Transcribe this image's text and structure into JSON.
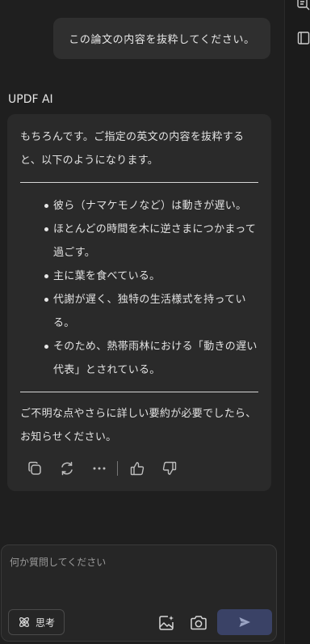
{
  "user_message": "この論文の内容を抜粋してください。",
  "assistant": {
    "name": "UPDF AI",
    "intro": "もちろんです。ご指定の英文の内容を抜粋すると、以下のようになります。",
    "bullets": [
      "彼ら（ナマケモノなど）は動きが遅い。",
      "ほとんどの時間を木に逆さまにつかまって過ごす。",
      "主に葉を食べている。",
      "代謝が遅く、独特の生活様式を持っている。",
      "そのため、熱帯雨林における「動きの遅い代表」とされている。"
    ],
    "outro": "ご不明な点やさらに詳しい要約が必要でしたら、お知らせください。",
    "actions": [
      "copy-icon",
      "regenerate-icon",
      "more-icon",
      "thumbs-up-icon",
      "thumbs-down-icon"
    ]
  },
  "composer": {
    "placeholder": "何か質問してください",
    "think_label": "思考",
    "icons": [
      "atom-icon",
      "image-edit-icon",
      "camera-icon",
      "send-icon"
    ]
  },
  "rail": {
    "icons": [
      "list-icon",
      "book-icon"
    ]
  },
  "colors": {
    "background": "#1f1f1f",
    "bubble": "#2f2f2f",
    "card": "#2a2a2a",
    "send_button": "#3a4266"
  }
}
